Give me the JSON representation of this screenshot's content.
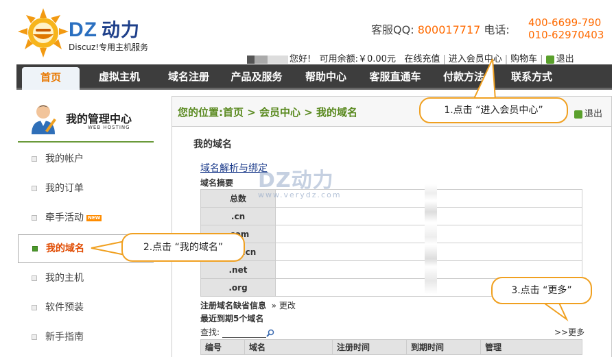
{
  "header": {
    "brand": "DZ",
    "brand_cn": "动力",
    "tagline": "Discuz!专用主机服务",
    "qq_label": "客服QQ:",
    "qq_number": "800017717",
    "phone_label": "电话:",
    "phones": [
      "400-6699-790",
      "010-62970403"
    ]
  },
  "userbar": {
    "greeting": "您好!",
    "balance": "可用余额:￥0.00元",
    "links": [
      "在线充值",
      "进入会员中心",
      "购物车"
    ],
    "logout": "退出"
  },
  "nav": {
    "items": [
      "首页",
      "虚拟主机",
      "域名注册",
      "产品及服务",
      "帮助中心",
      "客服直通车",
      "付款方法",
      "联系方式"
    ],
    "active": "首页"
  },
  "sidebar": {
    "title": "我的管理中心",
    "subtitle": "WEB HOSTING",
    "items": [
      "我的帐户",
      "我的订单",
      "牵手活动",
      "我的域名",
      "我的主机",
      "软件预装",
      "新手指南"
    ],
    "new_badge": "NEW",
    "active": "我的域名"
  },
  "main": {
    "breadcrumb": "您的位置:首页 > 会员中心 > 我的域名",
    "logout": "退出",
    "page_title": "我的域名",
    "dns_link": "域名解析与绑定",
    "summary_label": "域名摘要",
    "summary_rows": [
      "总数",
      ".cn",
      ".com",
      ".com.cn",
      ".net",
      ".org"
    ],
    "reg_info_label": "注册域名缺省信息",
    "reg_info_link": "» 更改",
    "recent_label": "最近到期5个域名",
    "search_label": "查找:",
    "more_link": ">>更多",
    "list_columns": [
      "编号",
      "域名",
      "注册时间",
      "到期时间",
      "管理"
    ]
  },
  "watermark": {
    "text": "DZ动力",
    "url": "www.verydz.com"
  },
  "callouts": [
    "1.点击 “进入会员中心”",
    "2.点击 “我的域名”",
    "3.点击 “更多”"
  ],
  "colors": {
    "accent_orange": "#ff6a00",
    "nav_bg": "#3d3d3d",
    "breadcrumb_green": "#5a8a20",
    "callout_border": "#f0a020"
  }
}
